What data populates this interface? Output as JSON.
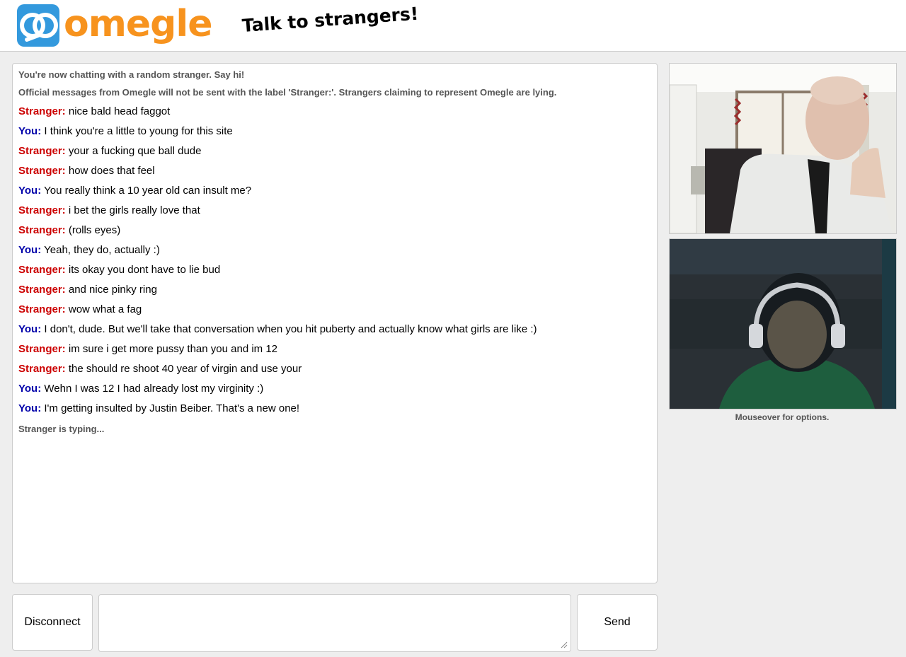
{
  "header": {
    "logo_text": "omegle",
    "tagline": "Talk to strangers!"
  },
  "chat": {
    "status_lines": [
      "You're now chatting with a random stranger. Say hi!",
      "Official messages from Omegle will not be sent with the label 'Stranger:'. Strangers claiming to represent Omegle are lying."
    ],
    "messages": [
      {
        "speaker": "Stranger:",
        "role": "stranger",
        "text": "nice bald head faggot"
      },
      {
        "speaker": "You:",
        "role": "you",
        "text": "I think you're a little to young for this site"
      },
      {
        "speaker": "Stranger:",
        "role": "stranger",
        "text": "your a fucking que ball dude"
      },
      {
        "speaker": "Stranger:",
        "role": "stranger",
        "text": "how does that feel"
      },
      {
        "speaker": "You:",
        "role": "you",
        "text": "You really think a 10 year old can insult me?"
      },
      {
        "speaker": "Stranger:",
        "role": "stranger",
        "text": "i bet the girls really love that"
      },
      {
        "speaker": "Stranger:",
        "role": "stranger",
        "text": "(rolls eyes)"
      },
      {
        "speaker": "You:",
        "role": "you",
        "text": "Yeah, they do, actually :)"
      },
      {
        "speaker": "Stranger:",
        "role": "stranger",
        "text": "its okay you dont have to lie bud"
      },
      {
        "speaker": "Stranger:",
        "role": "stranger",
        "text": "and nice pinky ring"
      },
      {
        "speaker": "Stranger:",
        "role": "stranger",
        "text": "wow what a fag"
      },
      {
        "speaker": "You:",
        "role": "you",
        "text": "I don't, dude. But we'll take that conversation when you hit puberty and actually know what girls are like :)"
      },
      {
        "speaker": "Stranger:",
        "role": "stranger",
        "text": "im sure i get more pussy than you and im 12"
      },
      {
        "speaker": "Stranger:",
        "role": "stranger",
        "text": "the should re shoot 40 year of virgin and use your"
      },
      {
        "speaker": "You:",
        "role": "you",
        "text": "Wehn I was 12 I had already lost my virginity :)"
      },
      {
        "speaker": "You:",
        "role": "you",
        "text": "I'm getting insulted by Justin Beiber. That's a new one!"
      }
    ],
    "typing_status": "Stranger is typing..."
  },
  "video": {
    "hint": "Mouseover for options."
  },
  "controls": {
    "disconnect_label": "Disconnect",
    "message_value": "",
    "send_label": "Send"
  },
  "colors": {
    "brand_orange": "#f7931e",
    "brand_blue": "#3399dd",
    "stranger": "#cc0000",
    "you": "#0000aa",
    "status_text": "#555555",
    "page_background": "#eeeeee"
  },
  "icons": {
    "logo": "omegle-logo-icon",
    "resize": "resize-grip-icon"
  }
}
